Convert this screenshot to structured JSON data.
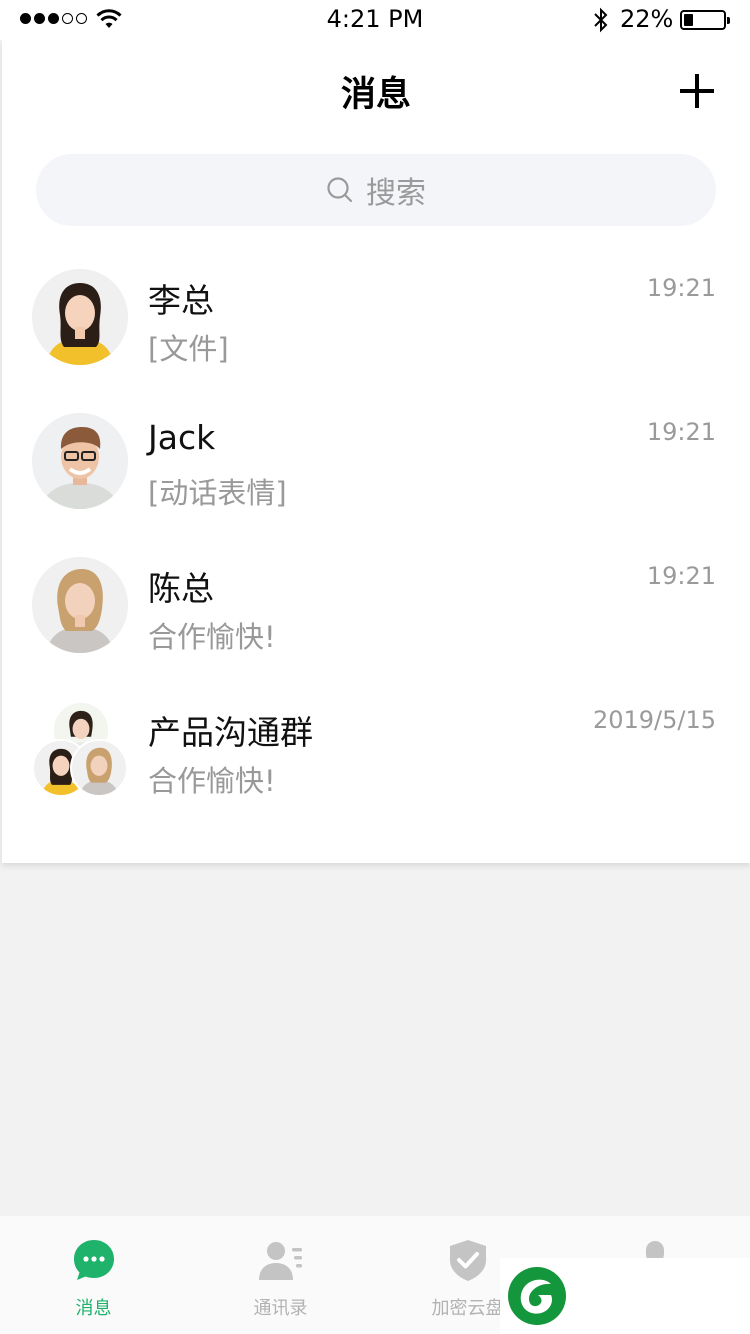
{
  "status_bar": {
    "time": "4:21 PM",
    "battery_percent": "22%",
    "battery_level": 0.22
  },
  "header": {
    "title": "消息"
  },
  "search": {
    "placeholder": "搜索"
  },
  "chats": [
    {
      "name": "李总",
      "preview": "[文件]",
      "time": "19:21"
    },
    {
      "name": "Jack",
      "preview": "[动话表情]",
      "time": "19:21"
    },
    {
      "name": "陈总",
      "preview": "合作愉快!",
      "time": "19:21"
    },
    {
      "name": "产品沟通群",
      "preview": "合作愉快!",
      "time": "2019/5/15"
    }
  ],
  "tab_bar": {
    "tabs": [
      {
        "label": "消息",
        "icon": "message-icon",
        "active": true
      },
      {
        "label": "通讯录",
        "icon": "contacts-icon",
        "active": false
      },
      {
        "label": "加密云盘",
        "icon": "shield-icon",
        "active": false
      },
      {
        "label": "",
        "icon": "profile-icon",
        "active": false
      }
    ]
  },
  "colors": {
    "accent": "#1fb26b",
    "inactive": "#b2b2b2",
    "logo_green": "#14963c"
  }
}
